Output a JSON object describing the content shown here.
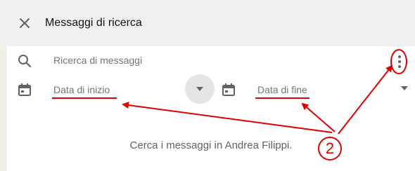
{
  "header": {
    "title": "Messaggi di ricerca"
  },
  "search": {
    "placeholder": "Ricerca di messaggi"
  },
  "filters": {
    "start_date_label": "Data di inizio",
    "end_date_label": "Data di fine"
  },
  "main": {
    "empty_message": "Cerca i messaggi in Andrea Filippi."
  },
  "annotation": {
    "step_number": "2",
    "color": "#e00000"
  },
  "icons": {
    "close": "close-icon",
    "search": "search-icon",
    "more": "more-vert-icon",
    "calendar": "calendar-icon",
    "dropdown": "caret-down-icon"
  }
}
